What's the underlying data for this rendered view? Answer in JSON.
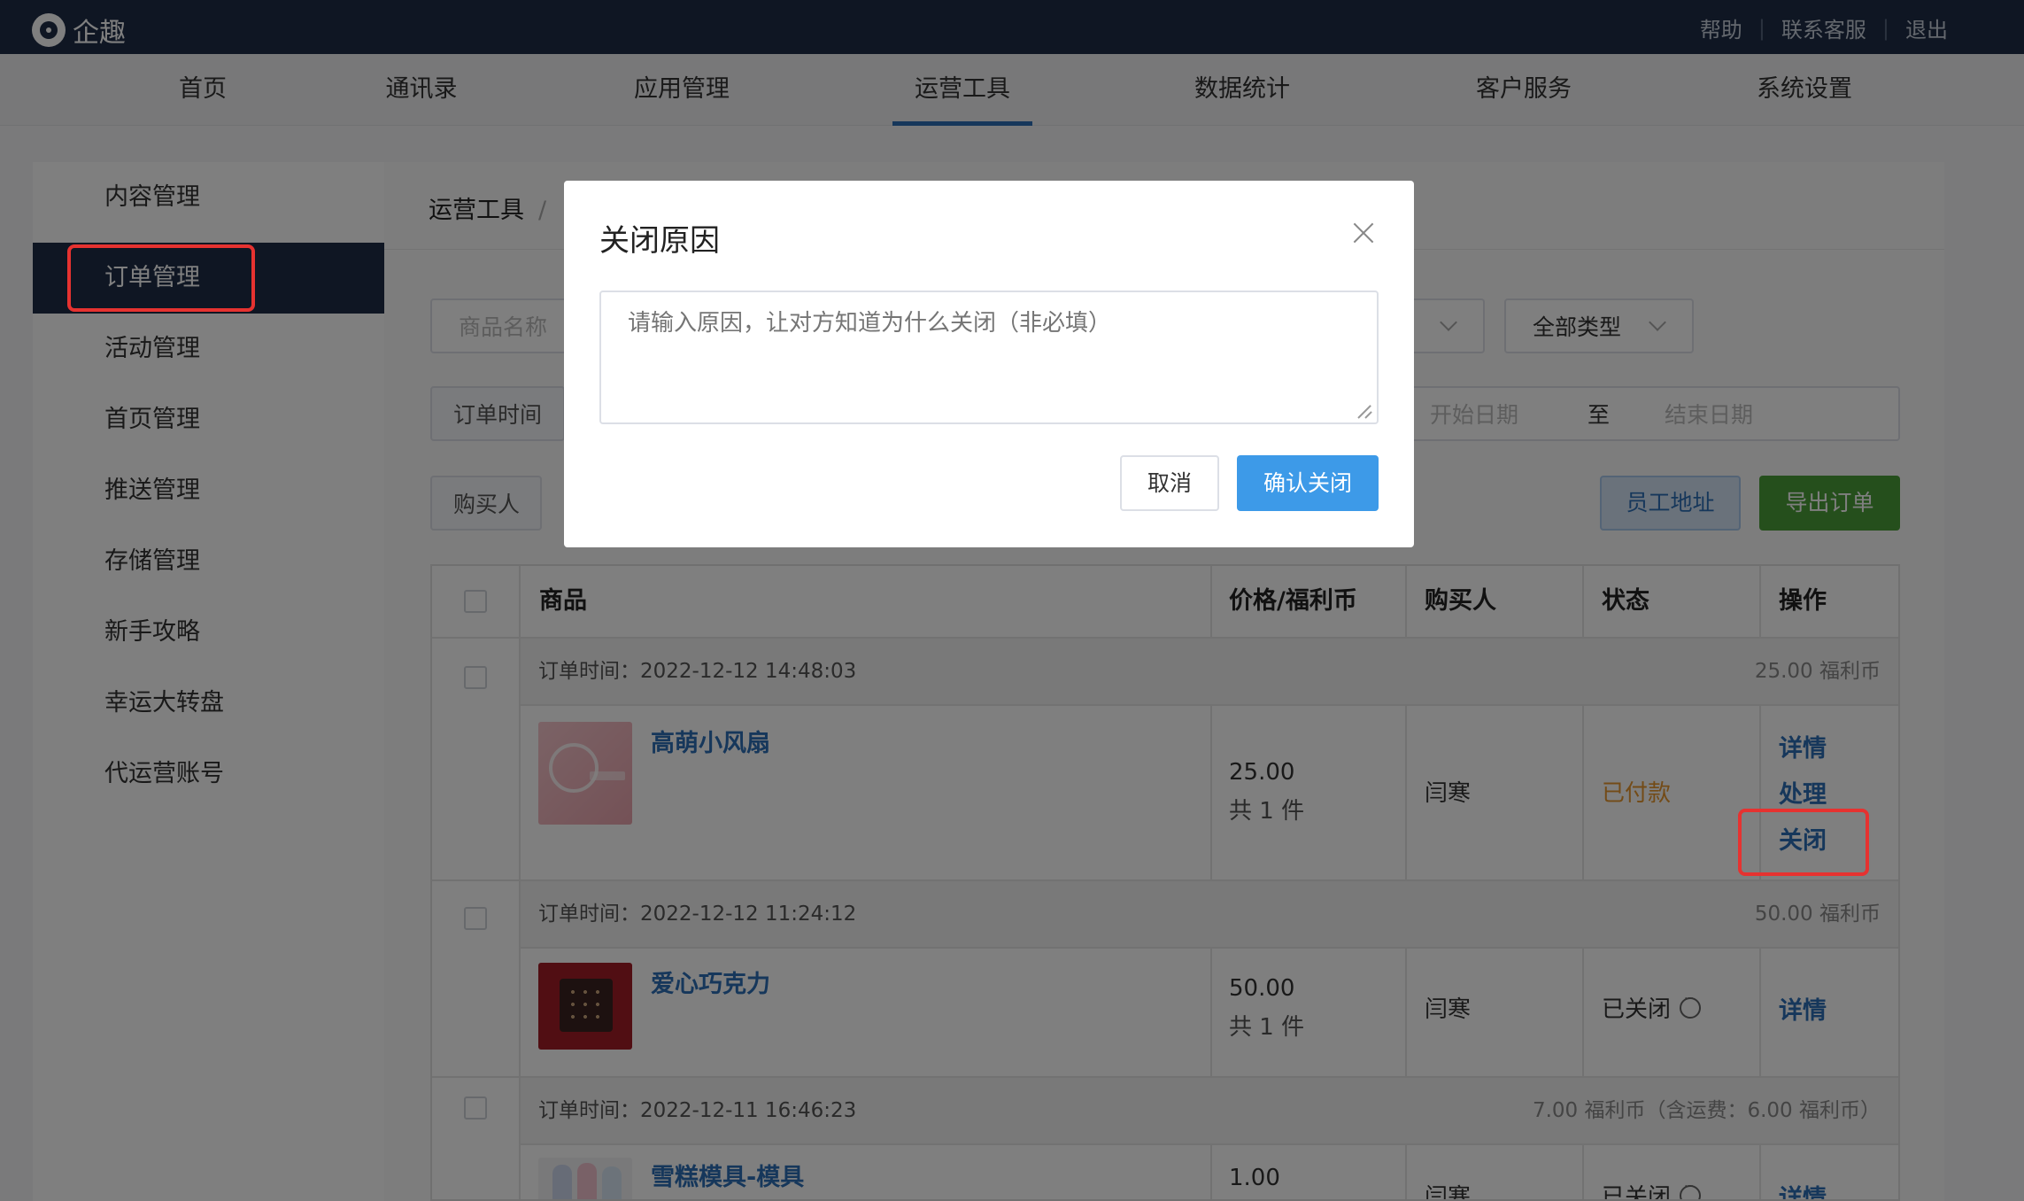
{
  "app": {
    "title": "企趣"
  },
  "toplinks": [
    "帮助",
    "联系客服",
    "退出"
  ],
  "nav": [
    "首页",
    "通讯录",
    "应用管理",
    "运营工具",
    "数据统计",
    "客户服务",
    "系统设置"
  ],
  "nav_active": "运营工具",
  "sidebar": [
    "内容管理",
    "订单管理",
    "活动管理",
    "首页管理",
    "推送管理",
    "存储管理",
    "新手攻略",
    "幸运大转盘",
    "代运营账号"
  ],
  "sidebar_active": "订单管理",
  "breadcrumb": {
    "root": "运营工具",
    "sep": "/"
  },
  "filters": {
    "product_name_placeholder": "商品名称",
    "type_select": "全部类型",
    "order_time_label": "订单时间",
    "start_date": "开始日期",
    "to": "至",
    "end_date": "结束日期",
    "buyer_label": "购买人"
  },
  "buttons": {
    "employee_address": "员工地址",
    "export_orders": "导出订单"
  },
  "table": {
    "headers": {
      "product": "商品",
      "price": "价格/福利币",
      "buyer": "购买人",
      "status": "状态",
      "ops": "操作"
    },
    "orders": [
      {
        "time": "订单时间：2022-12-12 14:48:03",
        "amount": "25.00 福利币",
        "name": "高萌小风扇",
        "price": "25.00",
        "count": "共 1 件",
        "buyer": "闫寒",
        "status": "已付款",
        "ops": [
          "详情",
          "处理",
          "关闭"
        ]
      },
      {
        "time": "订单时间：2022-12-12 11:24:12",
        "amount": "50.00 福利币",
        "name": "爱心巧克力",
        "price": "50.00",
        "count": "共 1 件",
        "buyer": "闫寒",
        "status": "已关闭",
        "ops": [
          "详情"
        ]
      },
      {
        "time": "订单时间：2022-12-11 16:46:23",
        "amount": "7.00 福利币（含运费：6.00 福利币）",
        "name": "雪糕模具-模具",
        "price": "1.00",
        "count": "",
        "buyer": "闫寒",
        "status": "已关闭",
        "ops": [
          "详情"
        ]
      }
    ]
  },
  "modal": {
    "title": "关闭原因",
    "placeholder": "请输入原因，让对方知道为什么关闭（非必填）",
    "cancel": "取消",
    "confirm": "确认关闭"
  },
  "colors": {
    "topbar": "#1e2d47",
    "accent": "#2d6fb7",
    "green": "#4b9e38",
    "highlight": "#e63230",
    "primary": "#3d9ae8",
    "paid": "#e6962e"
  }
}
